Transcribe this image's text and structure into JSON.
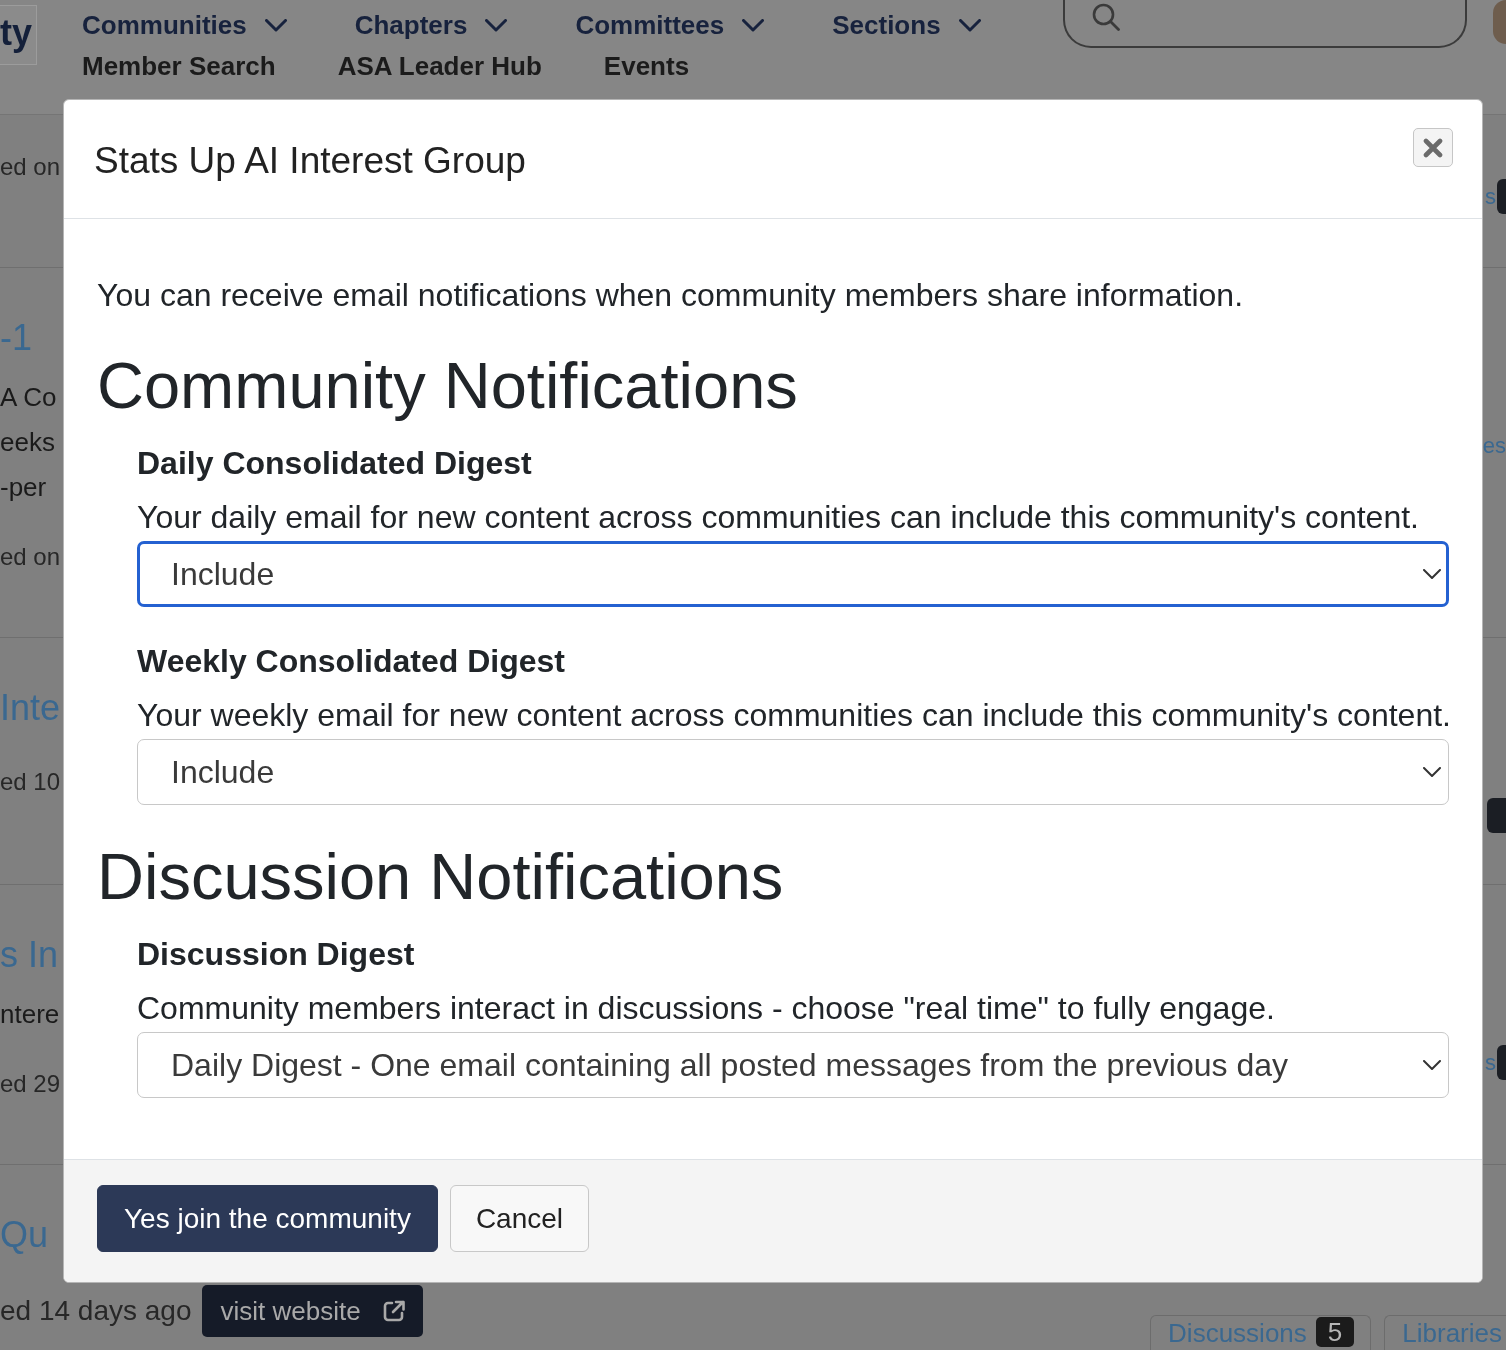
{
  "header": {
    "logo": "ty",
    "nav_rows": [
      {
        "items": [
          {
            "label": "Communities",
            "has_menu": true
          },
          {
            "label": "Chapters",
            "has_menu": true
          },
          {
            "label": "Committees",
            "has_menu": true
          },
          {
            "label": "Sections",
            "has_menu": true
          }
        ]
      },
      {
        "items": [
          {
            "label": "Member Search",
            "has_menu": false
          },
          {
            "label": "ASA Leader Hub",
            "has_menu": false
          },
          {
            "label": "Events",
            "has_menu": false
          }
        ]
      }
    ]
  },
  "listings": [
    {
      "meta": "ed on",
      "side_link": "s",
      "side_badge": true
    },
    {
      "title": "-1",
      "lines": [
        "A Co",
        "eeks",
        "-per"
      ],
      "meta": "ed on",
      "side_link": "es",
      "side_badge": false
    },
    {
      "title": "Inte",
      "meta": "ed 10",
      "side_badge": true
    },
    {
      "title": "s In",
      "lines": [
        "ntere"
      ],
      "meta": "ed 29",
      "side_link": "s",
      "side_badge": true
    },
    {
      "title": "Qu",
      "meta": "ed 14 days ago",
      "website_button": "visit website",
      "side_badge": false,
      "tabs": [
        {
          "label": "Discussions",
          "count": "5"
        },
        {
          "label": "Libraries"
        }
      ]
    }
  ],
  "modal": {
    "title": "Stats Up AI Interest Group",
    "intro": "You can receive email notifications when community members share information.",
    "sections": [
      {
        "heading": "Community Notifications",
        "settings": [
          {
            "label": "Daily Consolidated Digest",
            "description": "Your daily email for new content across communities can include this community's content.",
            "value": "Include",
            "focused": true
          },
          {
            "label": "Weekly Consolidated Digest",
            "description": "Your weekly email for new content across communities can include this community's content.",
            "value": "Include",
            "focused": false
          }
        ]
      },
      {
        "heading": "Discussion Notifications",
        "settings": [
          {
            "label": "Discussion Digest",
            "description": "Community members interact in discussions - choose \"real time\" to fully engage.",
            "value": "Daily Digest - One email containing all posted messages from the previous day",
            "focused": false
          }
        ]
      }
    ],
    "buttons": [
      {
        "label": "Yes join the community",
        "kind": "primary"
      },
      {
        "label": "Cancel",
        "kind": "secondary"
      }
    ]
  }
}
